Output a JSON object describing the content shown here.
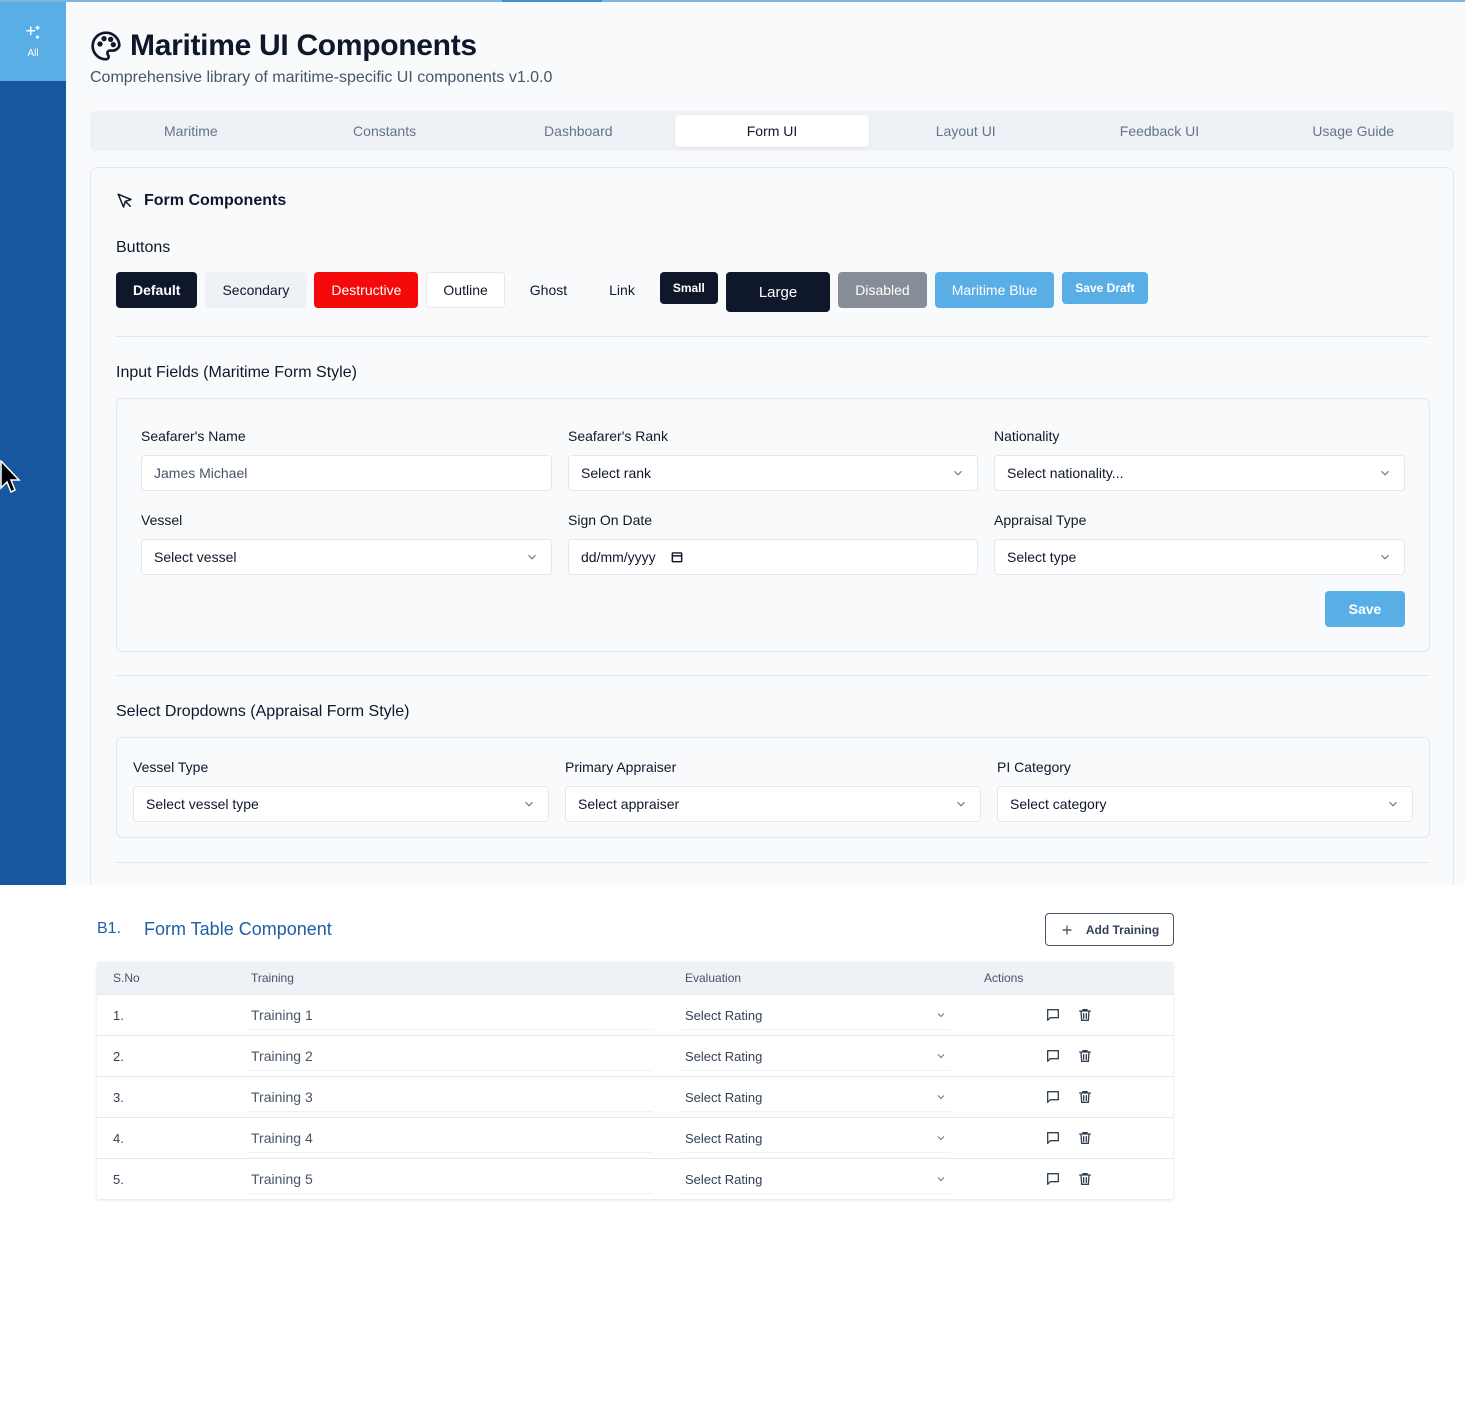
{
  "sidebar": {
    "all_label": "All"
  },
  "header": {
    "title": "Maritime UI Components",
    "subtitle": "Comprehensive library of maritime-specific UI components v1.0.0"
  },
  "tabs": [
    "Maritime",
    "Constants",
    "Dashboard",
    "Form UI",
    "Layout UI",
    "Feedback UI",
    "Usage Guide"
  ],
  "active_tab": "Form UI",
  "card": {
    "title": "Form Components"
  },
  "buttons_section": {
    "label": "Buttons",
    "default": "Default",
    "secondary": "Secondary",
    "destructive": "Destructive",
    "outline": "Outline",
    "ghost": "Ghost",
    "link": "Link",
    "small": "Small",
    "large": "Large",
    "disabled": "Disabled",
    "maritime_blue": "Maritime Blue",
    "save_draft": "Save Draft"
  },
  "inputs_section": {
    "label": "Input Fields (Maritime Form Style)",
    "seafarer_name_label": "Seafarer's Name",
    "seafarer_name_placeholder": "James Michael",
    "seafarer_rank_label": "Seafarer's Rank",
    "seafarer_rank_value": "Select rank",
    "nationality_label": "Nationality",
    "nationality_value": "Select nationality...",
    "vessel_label": "Vessel",
    "vessel_value": "Select vessel",
    "sign_on_label": "Sign On Date",
    "sign_on_value": "dd/mm/yyyy",
    "appraisal_type_label": "Appraisal Type",
    "appraisal_type_value": "Select type",
    "save": "Save"
  },
  "selects_section": {
    "label": "Select Dropdowns (Appraisal Form Style)",
    "vessel_type_label": "Vessel Type",
    "vessel_type_value": "Select vessel type",
    "primary_appraiser_label": "Primary Appraiser",
    "primary_appraiser_value": "Select appraiser",
    "pi_category_label": "PI Category",
    "pi_category_value": "Select category"
  },
  "table_section": {
    "prefix": "B1.",
    "title": "Form Table Component",
    "add_button": "Add Training",
    "columns": {
      "sno": "S.No",
      "training": "Training",
      "evaluation": "Evaluation",
      "actions": "Actions"
    },
    "rows": [
      {
        "sno": "1.",
        "training": "Training 1",
        "evaluation": "Select Rating"
      },
      {
        "sno": "2.",
        "training": "Training 2",
        "evaluation": "Select Rating"
      },
      {
        "sno": "3.",
        "training": "Training 3",
        "evaluation": "Select Rating"
      },
      {
        "sno": "4.",
        "training": "Training 4",
        "evaluation": "Select Rating"
      },
      {
        "sno": "5.",
        "training": "Training 5",
        "evaluation": "Select Rating"
      }
    ]
  },
  "colors": {
    "sidebar": "#17579f",
    "accent": "#5aaee6",
    "destructive": "#f50a0a",
    "primary": "#0f172a",
    "table_title": "#1d5fa8"
  },
  "icons": {
    "logo": "palette-icon",
    "card": "cursor-pointer-icon",
    "sidebar": "sparkles-icon",
    "add": "plus-icon",
    "comment": "message-square-icon",
    "delete": "trash-icon",
    "select": "chevron-down-icon",
    "date": "calendar-icon"
  }
}
